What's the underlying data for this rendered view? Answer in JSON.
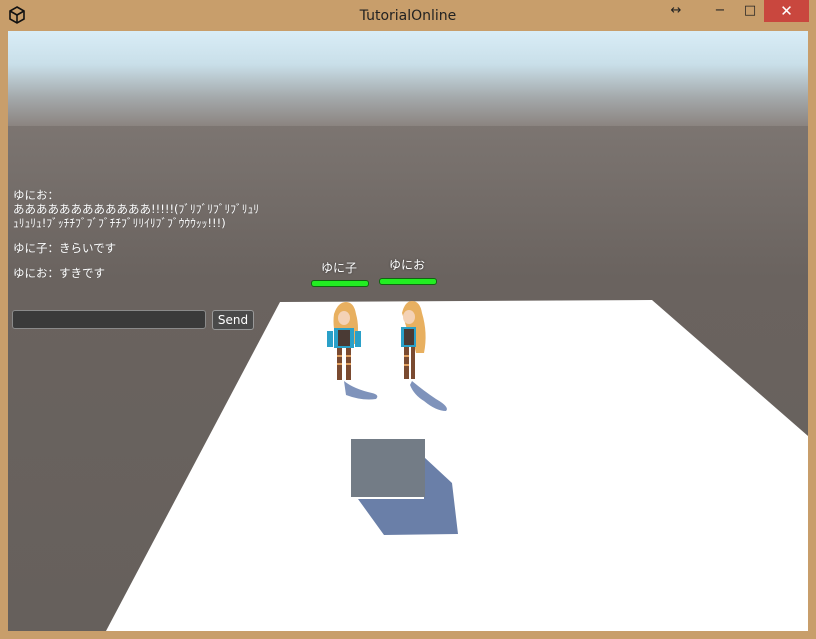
{
  "window": {
    "title": "TutorialOnline",
    "buttons": {
      "resize": "↔",
      "minimize": "−",
      "maximize": "□",
      "close": "✕"
    }
  },
  "chat": {
    "messages": [
      {
        "text": "ゆにお：\nああああああああああああ!!!!!(ﾌﾞﾘﾌﾞﾘﾌﾞﾘﾌﾞﾘｭﾘｭﾘｭﾘｭ!ﾌﾞｯﾁﾁﾌﾞﾌﾞﾌﾞﾁﾁﾌﾞﾘﾘｲﾘﾌﾞﾌﾞｳｳｳｯｯ!!!)"
      },
      {
        "text": "ゆに子：きらいです"
      },
      {
        "text": "ゆにお：すきです"
      }
    ],
    "input_value": "",
    "send_label": "Send"
  },
  "players": [
    {
      "name": "ゆに子",
      "hp": 1.0
    },
    {
      "name": "ゆにお",
      "hp": 1.0
    }
  ],
  "colors": {
    "sky_top": "#d8ecf6",
    "horizon": "#8a837e",
    "ground": "#66605c",
    "plane": "#ffffff",
    "cube": "#737c86",
    "hp": "#22ee22"
  }
}
